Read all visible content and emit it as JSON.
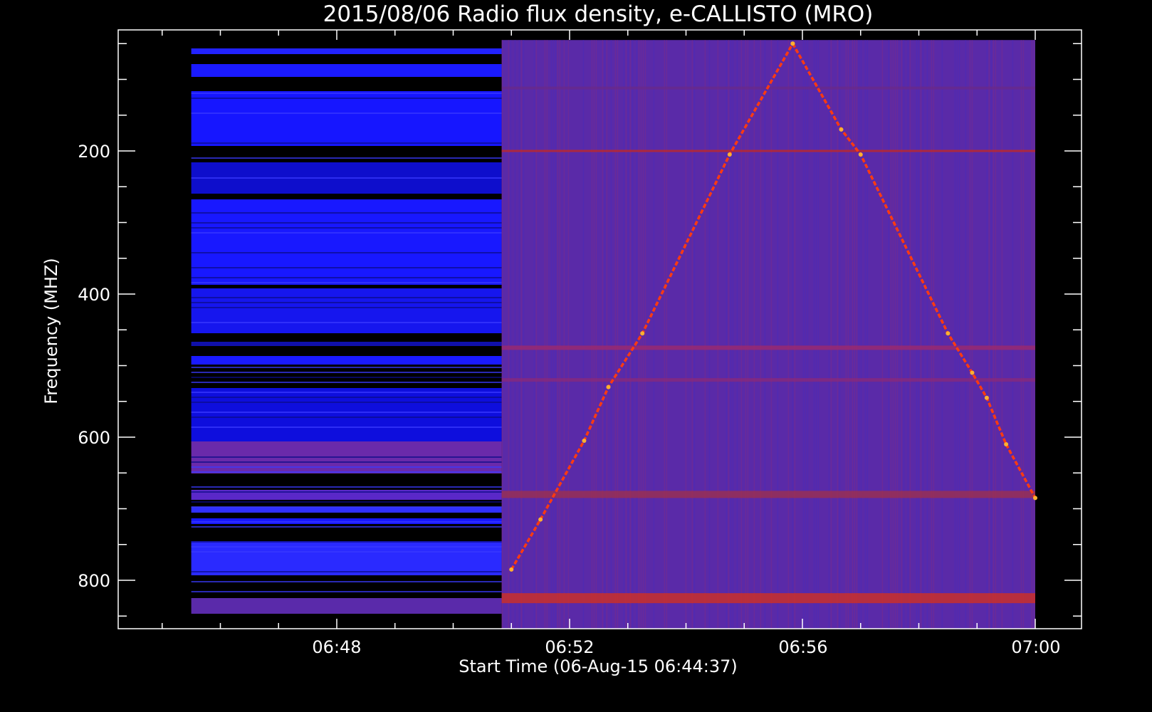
{
  "chart_data": {
    "type": "heatmap",
    "title": "2015/08/06  Radio flux density, e-CALLISTO (MRO)",
    "xlabel": "Start Time (06-Aug-15 06:44:37)",
    "ylabel": "Frequency (MHZ)",
    "x_ticks": [
      "06:48",
      "06:52",
      "06:56",
      "07:00"
    ],
    "y_ticks": [
      "200",
      "400",
      "600",
      "800"
    ],
    "y_range_mhz": [
      30,
      870
    ],
    "y_inverted": true,
    "data_extent": {
      "time_start": "06:45:30",
      "time_end": "07:00:00",
      "freq_low_mhz": 45,
      "freq_high_mhz": 870,
      "receiver_switch_time": "06:50:50"
    },
    "bursts": [
      {
        "name": "rising",
        "points": [
          {
            "time": "06:51:00",
            "freq_mhz": 785
          },
          {
            "time": "06:51:30",
            "freq_mhz": 715
          },
          {
            "time": "06:52:15",
            "freq_mhz": 605
          },
          {
            "time": "06:52:40",
            "freq_mhz": 530
          },
          {
            "time": "06:53:15",
            "freq_mhz": 455
          },
          {
            "time": "06:54:45",
            "freq_mhz": 205
          },
          {
            "time": "06:55:50",
            "freq_mhz": 50
          }
        ]
      },
      {
        "name": "falling",
        "points": [
          {
            "time": "06:55:50",
            "freq_mhz": 50
          },
          {
            "time": "06:56:40",
            "freq_mhz": 170
          },
          {
            "time": "06:57:00",
            "freq_mhz": 205
          },
          {
            "time": "06:58:30",
            "freq_mhz": 455
          },
          {
            "time": "06:58:55",
            "freq_mhz": 510
          },
          {
            "time": "06:59:10",
            "freq_mhz": 545
          },
          {
            "time": "06:59:30",
            "freq_mhz": 610
          },
          {
            "time": "07:00:00",
            "freq_mhz": 685
          }
        ]
      }
    ],
    "colors": {
      "background": "#000000",
      "axis": "#ffffff",
      "left_band": "#1515ff",
      "right_background": "#5a2aa8",
      "burst": "#ff3a10"
    }
  }
}
